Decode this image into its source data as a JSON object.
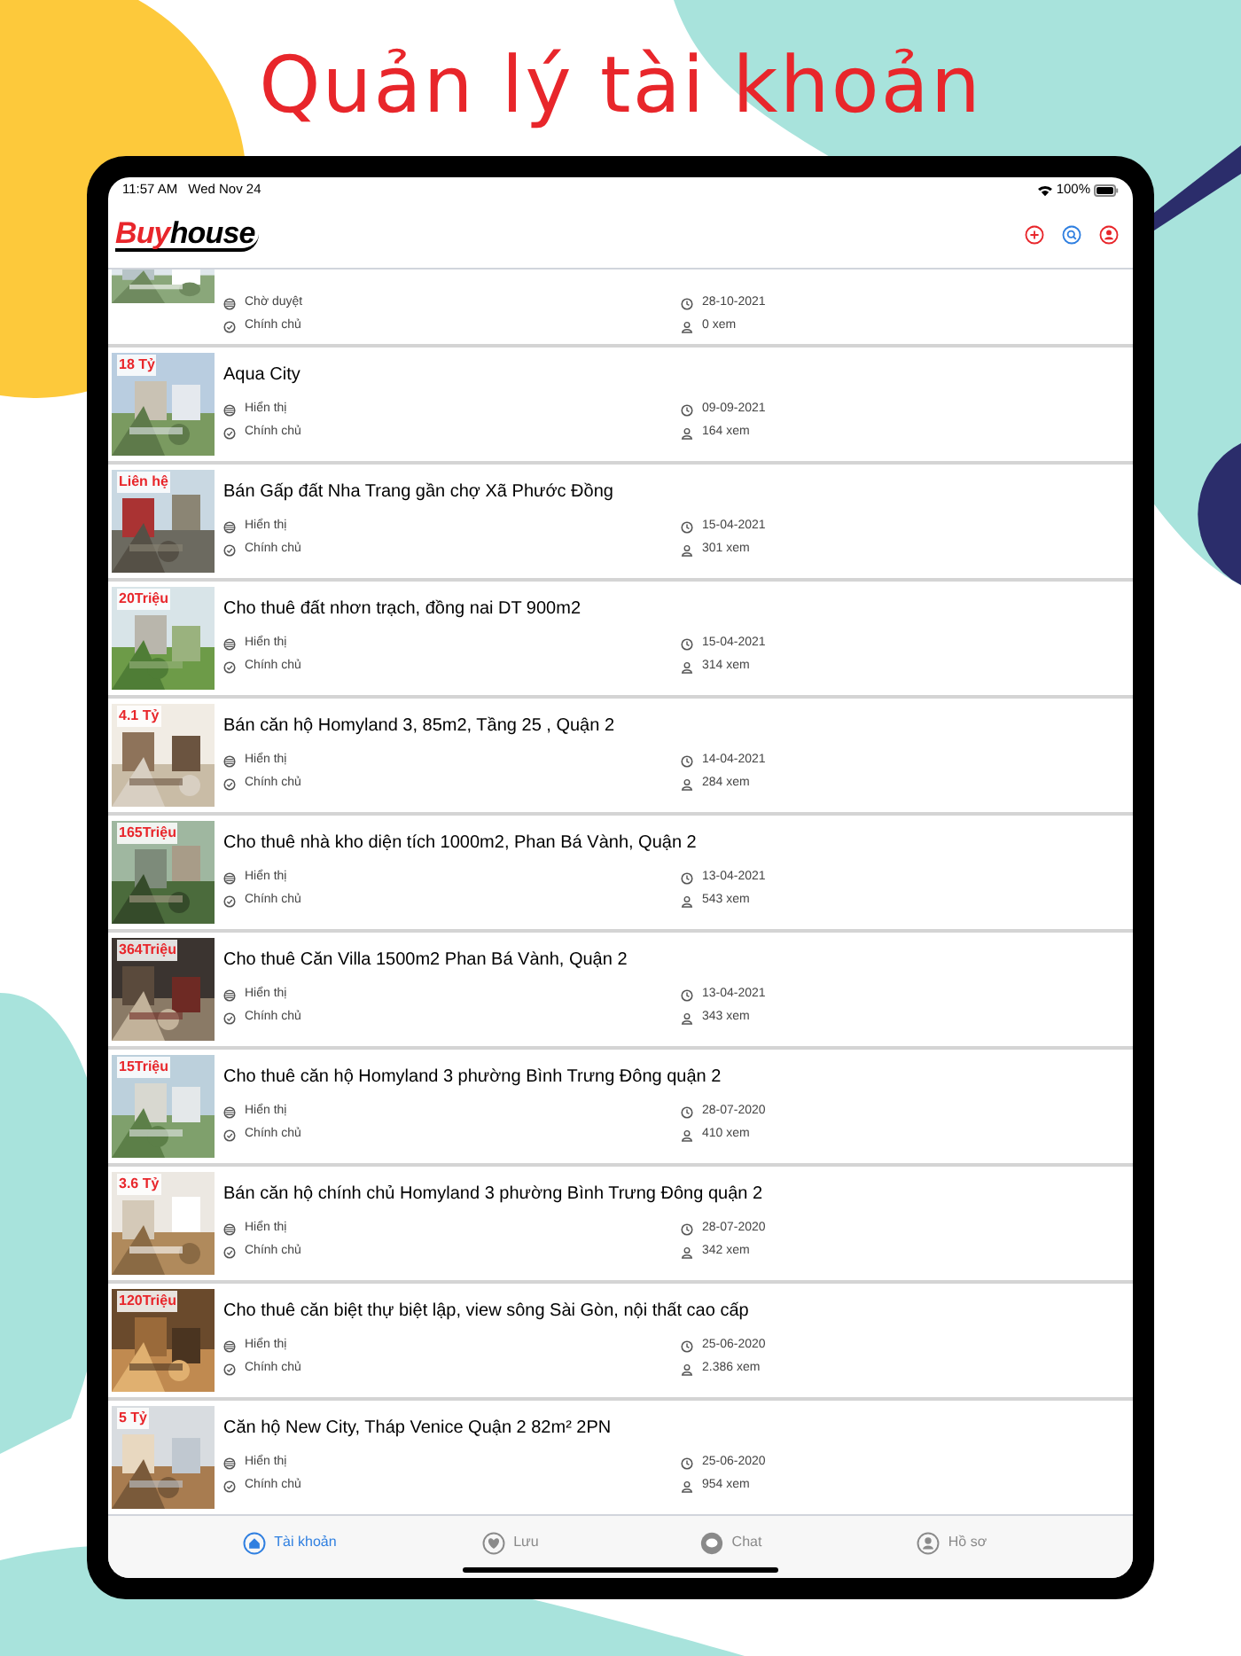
{
  "headline": "Quản lý tài khoản",
  "status_bar": {
    "time": "11:57 AM",
    "date": "Wed Nov 24",
    "battery": "100%"
  },
  "app_bar": {
    "logo": {
      "brand": "Buy",
      "suffix": "house"
    }
  },
  "listings": [
    {
      "kind": "partial",
      "status": "Chờ duyệt",
      "ownership": "Chính chủ",
      "date": "28-10-2021",
      "views": "0 xem"
    },
    {
      "kind": "full",
      "price": "18 Tỷ",
      "title": "Aqua City",
      "status": "Hiển thị",
      "ownership": "Chính chủ",
      "date": "09-09-2021",
      "views": "164 xem"
    },
    {
      "kind": "full",
      "price": "Liên hệ",
      "title": "Bán Gấp đất Nha Trang gần chợ Xã Phước Đồng",
      "status": "Hiển thị",
      "ownership": "Chính chủ",
      "date": "15-04-2021",
      "views": "301 xem"
    },
    {
      "kind": "full",
      "price": "20Triệu",
      "title": "Cho thuê đất nhơn trạch, đồng nai DT 900m2",
      "status": "Hiển thị",
      "ownership": "Chính chủ",
      "date": "15-04-2021",
      "views": "314 xem"
    },
    {
      "kind": "full",
      "price": "4.1 Tỷ",
      "title": "Bán căn hộ Homyland 3, 85m2, Tầng 25 , Quận 2",
      "status": "Hiển thị",
      "ownership": "Chính chủ",
      "date": "14-04-2021",
      "views": "284 xem"
    },
    {
      "kind": "full",
      "price": "165Triệu",
      "title": "Cho thuê nhà kho diện tích 1000m2, Phan Bá Vành, Quận 2",
      "status": "Hiển thị",
      "ownership": "Chính chủ",
      "date": "13-04-2021",
      "views": "543 xem"
    },
    {
      "kind": "full",
      "price": "364Triệu",
      "title": "Cho thuê Căn Villa 1500m2  Phan Bá Vành, Quận 2",
      "status": "Hiển thị",
      "ownership": "Chính chủ",
      "date": "13-04-2021",
      "views": "343 xem"
    },
    {
      "kind": "full",
      "price": "15Triệu",
      "title": "Cho thuê căn hộ Homyland 3 phường Bình Trưng Đông quận 2",
      "status": "Hiển thị",
      "ownership": "Chính chủ",
      "date": "28-07-2020",
      "views": "410 xem"
    },
    {
      "kind": "full",
      "price": "3.6 Tỷ",
      "title": "Bán căn hộ chính chủ Homyland 3 phường Bình Trưng Đông quận 2",
      "status": "Hiển thị",
      "ownership": "Chính chủ",
      "date": "28-07-2020",
      "views": "342 xem"
    },
    {
      "kind": "full",
      "price": "120Triệu",
      "title": "Cho thuê căn biệt thự biệt lập, view sông Sài Gòn, nội thất cao cấp",
      "status": "Hiển thị",
      "ownership": "Chính chủ",
      "date": "25-06-2020",
      "views": "2.386 xem"
    },
    {
      "kind": "full",
      "price": "5 Tỷ",
      "title": "Căn hộ New City, Tháp Venice Quận 2 82m² 2PN",
      "status": "Hiển thị",
      "ownership": "Chính chủ",
      "date": "25-06-2020",
      "views": "954 xem"
    }
  ],
  "tabs": [
    {
      "label": "Tài khoản",
      "selected": true
    },
    {
      "label": "Lưu",
      "selected": false
    },
    {
      "label": "Chat",
      "selected": false
    },
    {
      "label": "Hồ sơ",
      "selected": false
    }
  ]
}
